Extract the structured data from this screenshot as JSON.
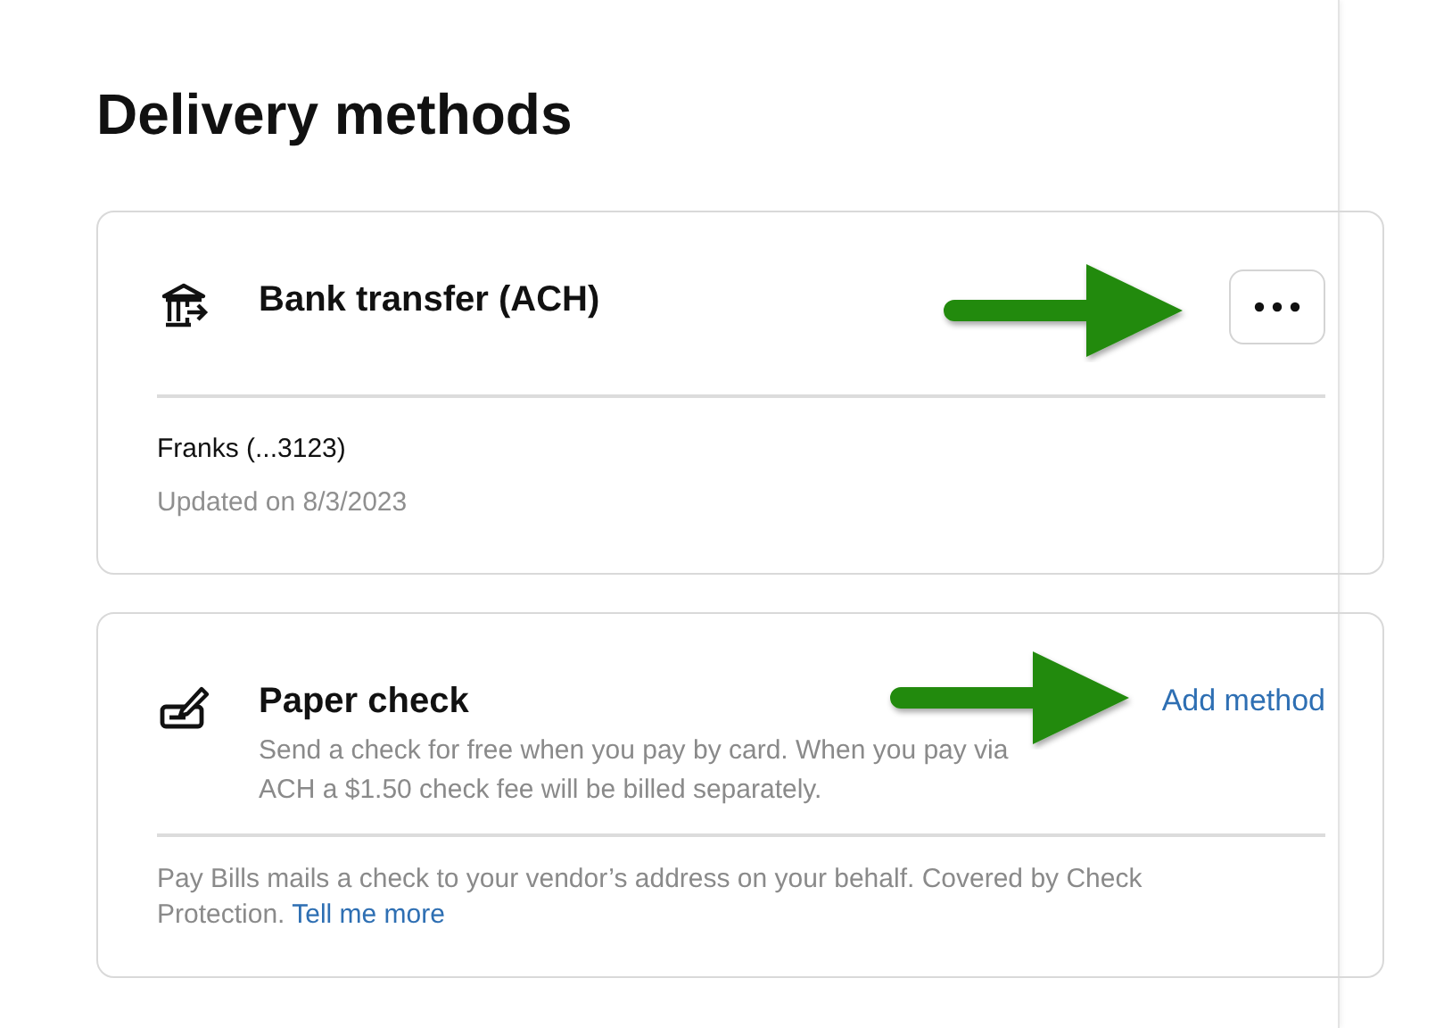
{
  "title": "Delivery methods",
  "methods": [
    {
      "kind": "bank",
      "title": "Bank transfer (ACH)",
      "action": {
        "kind": "menu"
      },
      "annotated": true,
      "details": [
        {
          "text": "Franks (...3123)",
          "muted": false
        },
        {
          "text": "Updated on 8/3/2023",
          "muted": true
        }
      ]
    },
    {
      "kind": "check",
      "title": "Paper check",
      "description": "Send a check for free when you pay by card. When you pay via ACH a $1.50 check fee will be billed separately.",
      "action": {
        "kind": "link",
        "label": "Add method"
      },
      "annotated": true,
      "note": "Pay Bills mails a check to your vendor’s address on your behalf. Covered by Check Protection.",
      "note_link": "Tell me more"
    }
  ]
}
